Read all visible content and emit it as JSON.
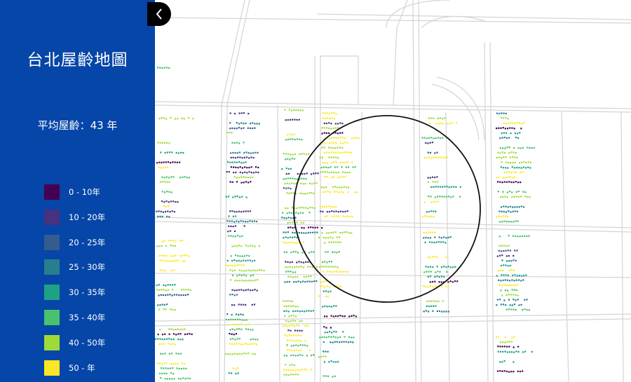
{
  "sidebar": {
    "title": "台北屋齡地圖",
    "average_label": "平均屋齡：43 年",
    "legend": [
      {
        "label": "0 - 10年",
        "color": "#440154"
      },
      {
        "label": "10 - 20年",
        "color": "#46327e"
      },
      {
        "label": "20 - 25年",
        "color": "#365c8d"
      },
      {
        "label": "25 - 30年",
        "color": "#277f8e"
      },
      {
        "label": "30 - 35年",
        "color": "#1fa187"
      },
      {
        "label": "35 - 40年",
        "color": "#4ac16d"
      },
      {
        "label": "40 - 50年",
        "color": "#a0da39"
      },
      {
        "label": "50 - 年",
        "color": "#fde725"
      }
    ]
  },
  "controls": {
    "collapse_icon": "chevron-left-icon"
  },
  "map": {
    "selection_shape": "circle",
    "background": "#ffffff",
    "road_color": "#d6d6d6"
  }
}
